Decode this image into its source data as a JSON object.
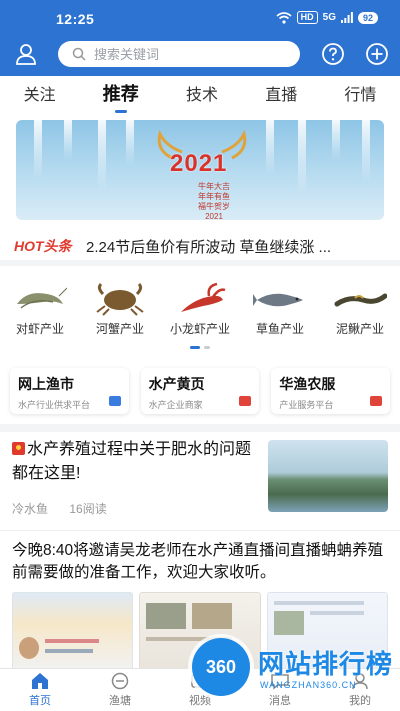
{
  "status_bar": {
    "time": "12:25",
    "hd": "HD",
    "signal": "5G",
    "battery": "92"
  },
  "header": {
    "search_placeholder": "搜索关键词"
  },
  "tabs": [
    {
      "label": "关注"
    },
    {
      "label": "推荐",
      "active": true
    },
    {
      "label": "技术"
    },
    {
      "label": "直播"
    },
    {
      "label": "行情"
    }
  ],
  "banner": {
    "year": "2021",
    "wish_lines": [
      "牛年大吉",
      "年年有鱼",
      "福牛贺岁",
      "2021"
    ]
  },
  "headline": {
    "tag": "HOT头条",
    "text": "2.24节后鱼价有所波动 草鱼继续涨 ..."
  },
  "categories": [
    {
      "label": "对虾产业",
      "icon": "shrimp-icon"
    },
    {
      "label": "河蟹产业",
      "icon": "crab-icon"
    },
    {
      "label": "小龙虾产业",
      "icon": "crayfish-icon"
    },
    {
      "label": "草鱼产业",
      "icon": "fish-icon"
    },
    {
      "label": "泥鳅产业",
      "icon": "loach-icon"
    }
  ],
  "service_cards": [
    {
      "title": "网上渔市",
      "subtitle": "水产行业供求平台",
      "color": "#3a7be0"
    },
    {
      "title": "水产黄页",
      "subtitle": "水产企业商家",
      "color": "#e0433a"
    },
    {
      "title": "华渔农服",
      "subtitle": "产业服务平台",
      "color": "#e0433a"
    }
  ],
  "article": {
    "title": "水产养殖过程中关于肥水的问题都在这里!",
    "source": "冷水鱼",
    "reads": "16阅读"
  },
  "post": {
    "title": "今晚8:40将邀请吴龙老师在水产通直播间直播蚺蚺养殖前需要做的准备工作，欢迎大家收听。"
  },
  "bottom_nav": [
    {
      "label": "首页",
      "active": true
    },
    {
      "label": "渔塘"
    },
    {
      "label": "视频"
    },
    {
      "label": "消息"
    },
    {
      "label": "我的"
    }
  ],
  "watermark": {
    "logo": "360",
    "name": "网站排行榜",
    "url": "WANGZHAN360.CN"
  },
  "colors": {
    "primary": "#2c73d2",
    "hot": "#e03a2f"
  }
}
